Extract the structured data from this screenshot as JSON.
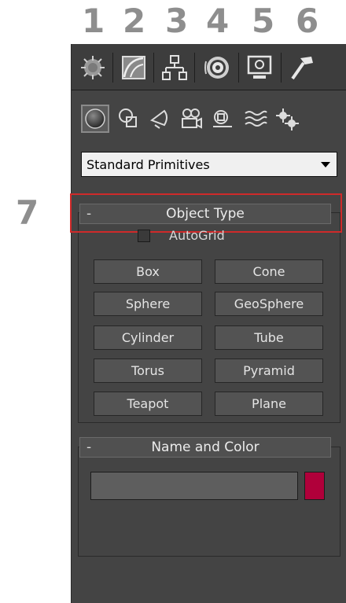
{
  "callouts": [
    "1",
    "2",
    "3",
    "4",
    "5",
    "6",
    "7"
  ],
  "tabs": [
    {
      "name": "create-icon"
    },
    {
      "name": "modify-icon"
    },
    {
      "name": "hierarchy-icon"
    },
    {
      "name": "motion-icon"
    },
    {
      "name": "display-icon"
    },
    {
      "name": "utilities-hammer-icon"
    }
  ],
  "categories": [
    {
      "name": "geometry-icon"
    },
    {
      "name": "shapes-icon"
    },
    {
      "name": "lights-icon"
    },
    {
      "name": "cameras-icon"
    },
    {
      "name": "helpers-icon"
    },
    {
      "name": "space-warps-icon"
    },
    {
      "name": "systems-icon"
    }
  ],
  "dropdown": {
    "value": "Standard Primitives"
  },
  "object_type": {
    "title": "Object Type",
    "collapse": "-",
    "autogrid": "AutoGrid",
    "buttons": [
      [
        "Box",
        "Cone"
      ],
      [
        "Sphere",
        "GeoSphere"
      ],
      [
        "Cylinder",
        "Tube"
      ],
      [
        "Torus",
        "Pyramid"
      ],
      [
        "Teapot",
        "Plane"
      ]
    ]
  },
  "name_color": {
    "title": "Name and Color",
    "collapse": "-",
    "name_value": "",
    "color": "#b0003a"
  },
  "colors": {
    "highlight": "#cf2a2a",
    "panel": "#444444"
  }
}
